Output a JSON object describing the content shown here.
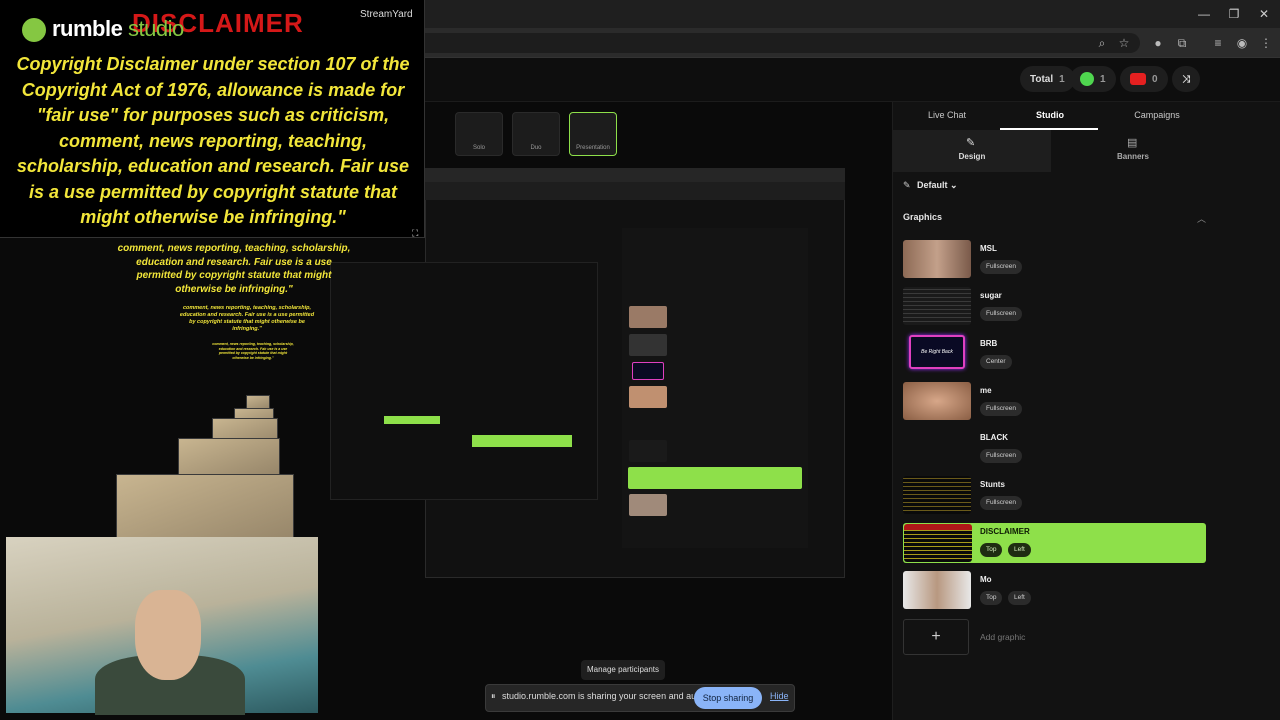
{
  "browser": {
    "url": "b",
    "window_controls": [
      "—",
      "❐",
      "✕"
    ]
  },
  "header": {
    "total_label": "Total",
    "total_count": "1",
    "rumble_count": "1",
    "youtube_count": "0"
  },
  "overlay": {
    "logo_main": "rumble",
    "logo_studio": "studio",
    "stamp": "DISCLAIMER",
    "brand": "StreamYard",
    "disclaimer": "Copyright Disclaimer under section 107 of the Copyright Act of 1976, allowance is made for \"fair use\" for purposes such as criticism, comment, news reporting, teaching, scholarship, education and research. Fair use is a use permitted by copyright statute that might otherwise be infringing.\"",
    "disclaimer_echo_1": "comment, news reporting, teaching, scholarship, education and research. Fair use is a use permitted by copyright statute that might otherwise be infringing.\"",
    "disclaimer_echo_2": "comment, news reporting, teaching, scholarship, education and research. Fair use is a use permitted by copyright statute that might otherwise be infringing.\"",
    "disclaimer_echo_3": "comment, news reporting, teaching, scholarship, education and research. Fair use is a use permitted by copyright statute that might otherwise be infringing.\""
  },
  "layouts": [
    "Solo",
    "Duo",
    "Presentation"
  ],
  "right_panel": {
    "tabs": [
      "Live Chat",
      "Studio",
      "Campaigns"
    ],
    "sub_tabs": [
      "Design",
      "Banners"
    ],
    "theme": "Default",
    "section": "Graphics",
    "graphics": [
      {
        "name": "MSL",
        "tags": [
          "Fullscreen"
        ]
      },
      {
        "name": "sugar",
        "tags": [
          "Fullscreen"
        ]
      },
      {
        "name": "BRB",
        "tags": [
          "Center"
        ]
      },
      {
        "name": "me",
        "tags": [
          "Fullscreen"
        ]
      },
      {
        "name": "BLACK",
        "tags": [
          "Fullscreen"
        ]
      },
      {
        "name": "Stunts",
        "tags": [
          "Fullscreen"
        ]
      },
      {
        "name": "DISCLAIMER",
        "tags": [
          "Top",
          "Left"
        ]
      },
      {
        "name": "Mo",
        "tags": [
          "Top",
          "Left"
        ]
      }
    ],
    "brb_text": "Be Right Back",
    "add_graphic": "Add graphic"
  },
  "bottom": {
    "manage_participants": "Manage participants",
    "share_text": "studio.rumble.com is sharing your screen and audio.",
    "stop_sharing": "Stop sharing",
    "hide": "Hide",
    "help": "?"
  },
  "colors": {
    "accent_green": "#8ee04a",
    "disclaimer_yellow": "#f2e63a",
    "stamp_red": "#d51818",
    "rumble_green": "#85c742"
  }
}
